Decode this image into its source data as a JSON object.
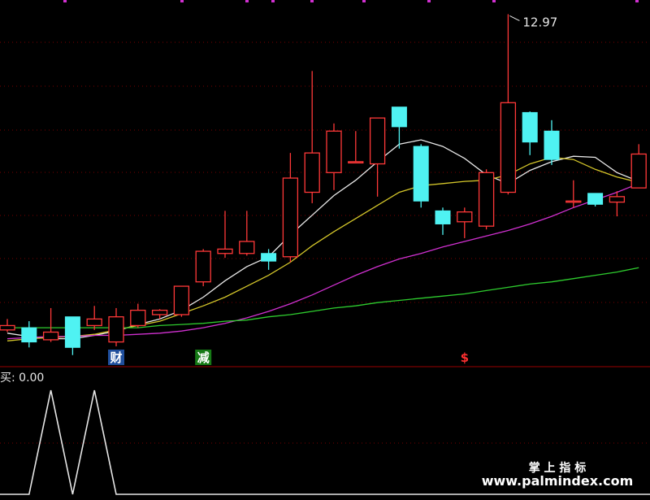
{
  "chart_data": {
    "type": "candlestick",
    "price_axis": {
      "min": 9.9,
      "max": 13.1
    },
    "high_label": "12.97",
    "candles": [
      {
        "o": 10.08,
        "h": 10.18,
        "l": 10.06,
        "c": 10.12
      },
      {
        "o": 10.1,
        "h": 10.16,
        "l": 9.92,
        "c": 9.97
      },
      {
        "o": 9.99,
        "h": 10.28,
        "l": 9.97,
        "c": 10.06
      },
      {
        "o": 10.2,
        "h": 10.2,
        "l": 9.85,
        "c": 9.92
      },
      {
        "o": 10.12,
        "h": 10.3,
        "l": 10.08,
        "c": 10.18
      },
      {
        "o": 9.97,
        "h": 10.28,
        "l": 9.93,
        "c": 10.2
      },
      {
        "o": 10.12,
        "h": 10.32,
        "l": 10.1,
        "c": 10.26
      },
      {
        "o": 10.22,
        "h": 10.27,
        "l": 10.18,
        "c": 10.26
      },
      {
        "o": 10.22,
        "h": 10.48,
        "l": 10.2,
        "c": 10.48
      },
      {
        "o": 10.52,
        "h": 10.82,
        "l": 10.48,
        "c": 10.8
      },
      {
        "o": 10.78,
        "h": 11.17,
        "l": 10.74,
        "c": 10.82
      },
      {
        "o": 10.78,
        "h": 11.17,
        "l": 10.76,
        "c": 10.89
      },
      {
        "o": 10.78,
        "h": 10.82,
        "l": 10.63,
        "c": 10.71
      },
      {
        "o": 10.75,
        "h": 11.7,
        "l": 10.7,
        "c": 11.47
      },
      {
        "o": 11.34,
        "h": 12.45,
        "l": 11.24,
        "c": 11.7
      },
      {
        "o": 11.52,
        "h": 11.97,
        "l": 11.36,
        "c": 11.9
      },
      {
        "o": 11.62,
        "h": 11.9,
        "l": 11.62,
        "c": 11.62
      },
      {
        "o": 11.6,
        "h": 12.02,
        "l": 11.3,
        "c": 12.02
      },
      {
        "o": 12.12,
        "h": 12.12,
        "l": 11.74,
        "c": 11.94
      },
      {
        "o": 11.76,
        "h": 11.78,
        "l": 11.2,
        "c": 11.26
      },
      {
        "o": 11.17,
        "h": 11.2,
        "l": 10.95,
        "c": 11.05
      },
      {
        "o": 11.07,
        "h": 11.2,
        "l": 10.92,
        "c": 11.16
      },
      {
        "o": 11.03,
        "h": 11.55,
        "l": 11.0,
        "c": 11.52
      },
      {
        "o": 11.34,
        "h": 12.97,
        "l": 11.32,
        "c": 12.16
      },
      {
        "o": 12.07,
        "h": 12.08,
        "l": 11.68,
        "c": 11.8
      },
      {
        "o": 11.9,
        "h": 12.0,
        "l": 11.59,
        "c": 11.64
      },
      {
        "o": 11.26,
        "h": 11.45,
        "l": 11.2,
        "c": 11.26
      },
      {
        "o": 11.33,
        "h": 11.33,
        "l": 11.21,
        "c": 11.23
      },
      {
        "o": 11.25,
        "h": 11.35,
        "l": 11.12,
        "c": 11.3
      },
      {
        "o": 11.38,
        "h": 11.78,
        "l": 11.38,
        "c": 11.69
      }
    ],
    "series": [
      {
        "color": "#e8e8e8",
        "values": [
          10.05,
          10.02,
          10.0,
          10.0,
          10.03,
          10.07,
          10.13,
          10.18,
          10.26,
          10.38,
          10.53,
          10.66,
          10.75,
          10.95,
          11.13,
          11.31,
          11.45,
          11.62,
          11.78,
          11.82,
          11.76,
          11.65,
          11.5,
          11.42,
          11.54,
          11.62,
          11.67,
          11.66,
          11.52,
          11.44
        ]
      },
      {
        "color": "#d4c62a",
        "values": [
          9.98,
          10.0,
          10.01,
          10.02,
          10.04,
          10.08,
          10.12,
          10.16,
          10.23,
          10.3,
          10.38,
          10.48,
          10.58,
          10.7,
          10.85,
          10.98,
          11.1,
          11.22,
          11.34,
          11.4,
          11.42,
          11.44,
          11.45,
          11.5,
          11.6,
          11.66,
          11.64,
          11.55,
          11.48,
          11.43
        ]
      },
      {
        "color": "#d030d0",
        "values": [
          10.0,
          10.01,
          10.02,
          10.02,
          10.03,
          10.03,
          10.04,
          10.05,
          10.07,
          10.1,
          10.14,
          10.19,
          10.25,
          10.32,
          10.4,
          10.49,
          10.58,
          10.66,
          10.73,
          10.78,
          10.84,
          10.89,
          10.94,
          10.99,
          11.05,
          11.12,
          11.2,
          11.27,
          11.34,
          11.42
        ]
      },
      {
        "color": "#2ecc2e",
        "values": [
          10.1,
          10.1,
          10.1,
          10.1,
          10.1,
          10.1,
          10.1,
          10.12,
          10.13,
          10.14,
          10.16,
          10.17,
          10.2,
          10.22,
          10.25,
          10.28,
          10.3,
          10.33,
          10.35,
          10.37,
          10.39,
          10.41,
          10.44,
          10.47,
          10.5,
          10.52,
          10.55,
          10.58,
          10.61,
          10.65
        ]
      }
    ],
    "signals": [
      {
        "index": 5,
        "label": "财",
        "bg": "#1f4e9c",
        "fg": "#ffffff"
      },
      {
        "index": 9,
        "label": "减",
        "bg": "#167a16",
        "fg": "#ffffff"
      },
      {
        "index": 21,
        "label": "$",
        "bg": "",
        "fg": "#ff3030"
      }
    ],
    "indicator": {
      "label": "买",
      "value_text": ": 0.00",
      "values": [
        0,
        0,
        1,
        0,
        1,
        0,
        0,
        0,
        0,
        0,
        0,
        0,
        0,
        0,
        0,
        0,
        0,
        0,
        0,
        0,
        0,
        0,
        0,
        0,
        0,
        0,
        0,
        0,
        0,
        0
      ]
    }
  },
  "watermark": {
    "line1": "掌 上 指 标",
    "line2": "www.palmindex.com"
  }
}
